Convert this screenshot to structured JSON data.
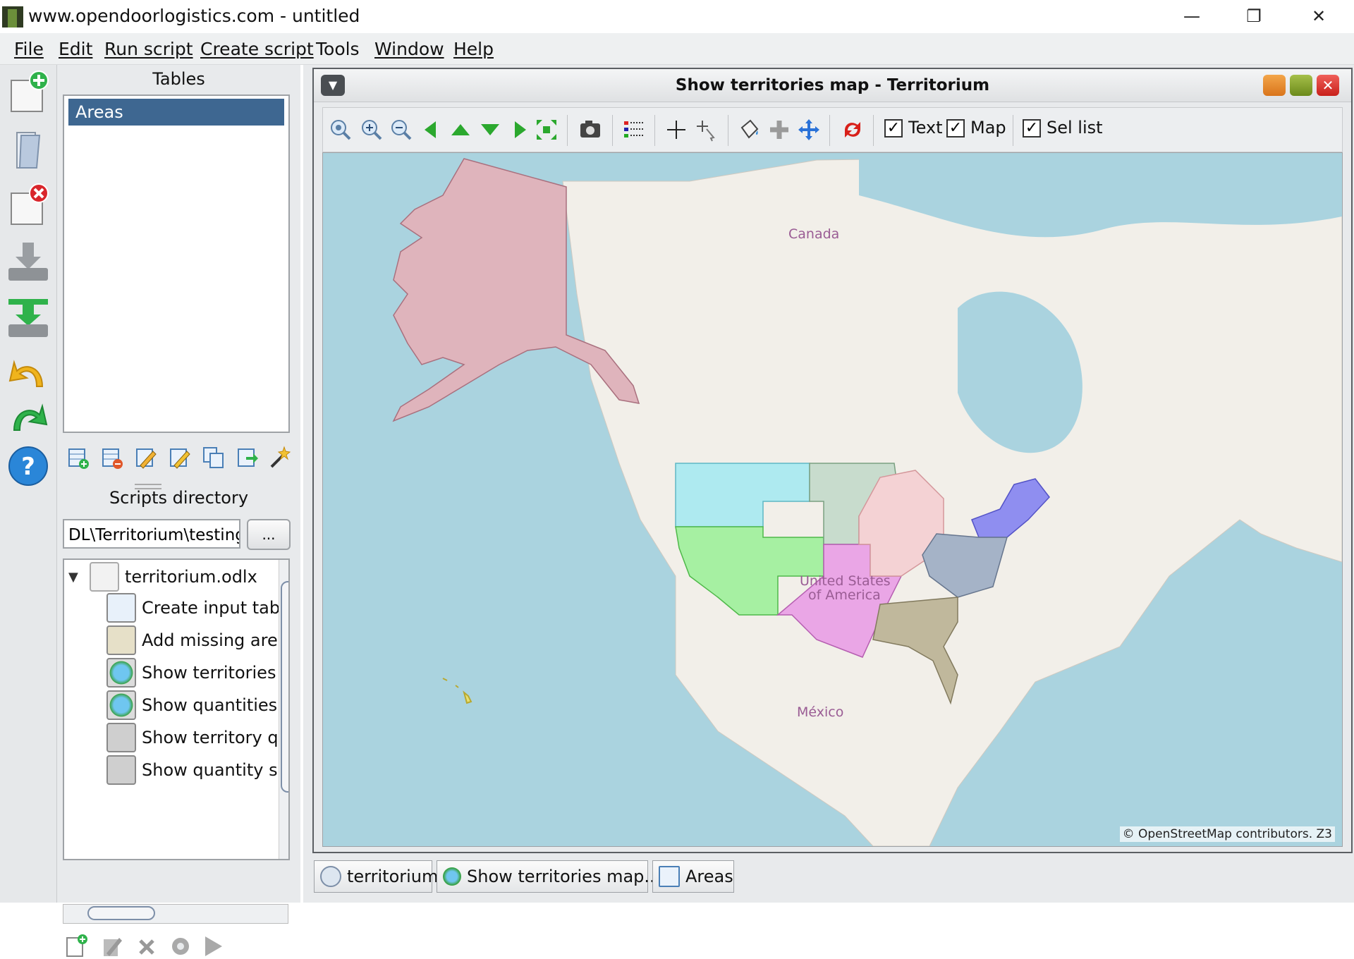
{
  "window": {
    "title": "www.opendoorlogistics.com - untitled",
    "minimize_glyph": "—",
    "restore_glyph": "❐",
    "close_glyph": "✕"
  },
  "menu": {
    "items": [
      "File",
      "Edit",
      "Run script",
      "Create script",
      "Tools",
      "Window",
      "Help"
    ]
  },
  "left_toolbar": {
    "icons": [
      "new-datastore-icon",
      "open-icon",
      "close-datastore-icon",
      "import-icon",
      "export-icon",
      "undo-icon",
      "redo-icon",
      "help-icon"
    ]
  },
  "tables": {
    "header": "Tables",
    "items": [
      "Areas"
    ],
    "toolbar_icons": [
      "add-table-icon",
      "delete-table-icon",
      "rename-table-icon",
      "edit-table-icon",
      "copy-table-icon",
      "export-table-icon",
      "wizard-icon"
    ]
  },
  "scripts": {
    "header": "Scripts directory",
    "path_value": "DL\\Territorium\\testing",
    "browse_label": "...",
    "tree_root": "territorium.odlx",
    "tree_expander": "▼",
    "items": [
      {
        "label": "Create input tab",
        "icon": "table-icon"
      },
      {
        "label": "Add missing are",
        "icon": "edit-icon"
      },
      {
        "label": "Show territories",
        "icon": "globe-icon"
      },
      {
        "label": "Show quantities",
        "icon": "globe-icon"
      },
      {
        "label": "Show territory qu",
        "icon": "binoculars-icon"
      },
      {
        "label": "Show quantity s",
        "icon": "binoculars-icon"
      }
    ],
    "bottom_icons": [
      "new-script-icon",
      "edit-script-icon",
      "delete-script-icon",
      "settings-icon",
      "run-icon"
    ]
  },
  "map_window": {
    "title": "Show territories map - Territorium",
    "toolbar": {
      "checkboxes": [
        {
          "label": "Text",
          "checked": true
        },
        {
          "label": "Map",
          "checked": true
        },
        {
          "label": "Sel list",
          "checked": true
        }
      ],
      "check_glyph": "✓"
    },
    "labels": {
      "canada": "Canada",
      "usa_line1": "United States",
      "usa_line2": "of America",
      "mexico": "México"
    },
    "attribution": "© OpenStreetMap contributors. Z3",
    "colors": {
      "alaska": "#dfb4bc",
      "northwest": "#aeeaf0",
      "southwest": "#a6f0a2",
      "plains": "#c8dccd",
      "south_central": "#eaa6e6",
      "midwest": "#f4d2d4",
      "northeast": "#8f8ef0",
      "mid_atlantic": "#a5b3c7",
      "southeast": "#c0b89c",
      "water": "#aad3df",
      "land": "#f2efe9"
    }
  },
  "bottom_tabs": [
    {
      "label": "territorium"
    },
    {
      "label": "Show territories map..."
    },
    {
      "label": "Areas"
    }
  ]
}
